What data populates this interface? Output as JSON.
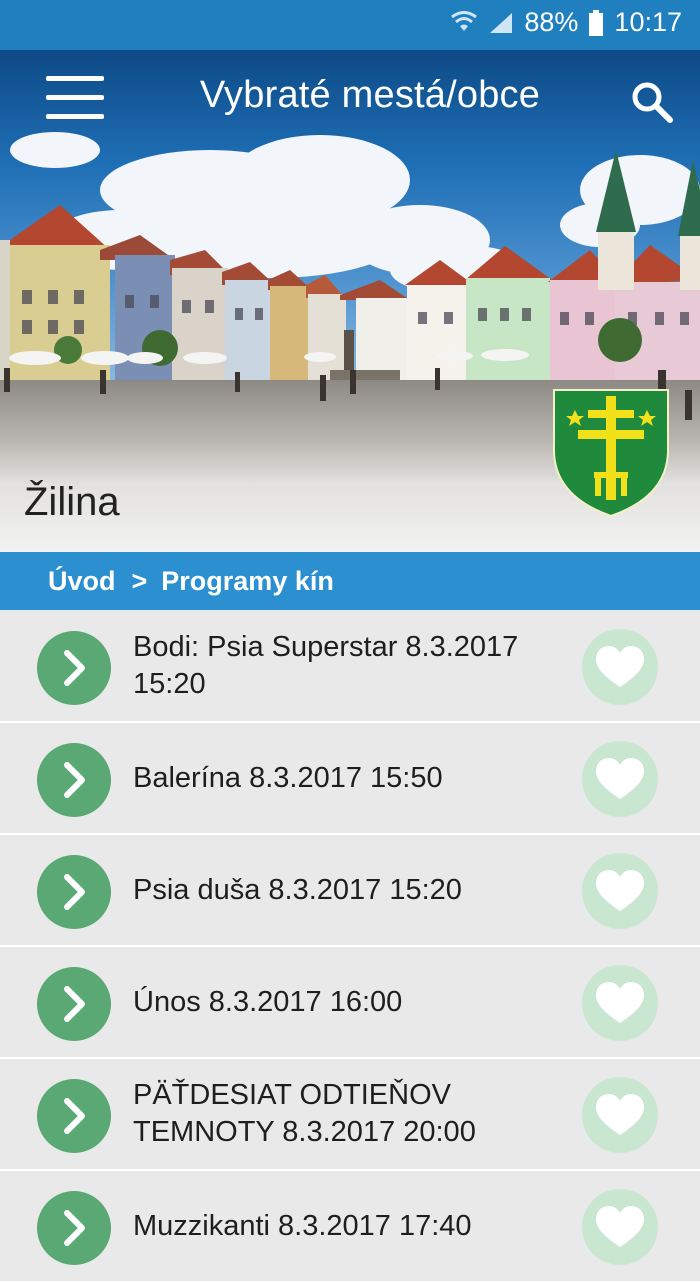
{
  "status_bar": {
    "battery": "88%",
    "time": "10:17"
  },
  "app_bar": {
    "title": "Vybraté mestá/obce"
  },
  "header": {
    "city_name": "Žilina"
  },
  "breadcrumb": {
    "home": "Úvod",
    "separator": ">",
    "current": "Programy kín"
  },
  "list": {
    "items": [
      {
        "line1": "Bodi: Psia Superstar 8.3.2017",
        "line2": "15:20"
      },
      {
        "line1": "Balerína 8.3.2017 15:50",
        "line2": ""
      },
      {
        "line1": "Psia duša 8.3.2017 15:20",
        "line2": ""
      },
      {
        "line1": "Únos 8.3.2017 16:00",
        "line2": ""
      },
      {
        "line1": "PÄŤDESIAT ODTIEŇOV",
        "line2": "TEMNOTY 8.3.2017 20:00"
      },
      {
        "line1": "Muzzikanti 8.3.2017 17:40",
        "line2": ""
      }
    ]
  },
  "colors": {
    "status_bar": "#1f7fbf",
    "breadcrumb_bar": "#2b8fd0",
    "go_button": "#5aa874",
    "favorite_button": "#c9e6d1",
    "list_background": "#e9e9e9"
  },
  "icons": {
    "menu": "hamburger-menu-icon",
    "search": "search-icon",
    "go": "chevron-right-icon",
    "favorite": "heart-icon",
    "crest": "zilina-coat-of-arms"
  }
}
